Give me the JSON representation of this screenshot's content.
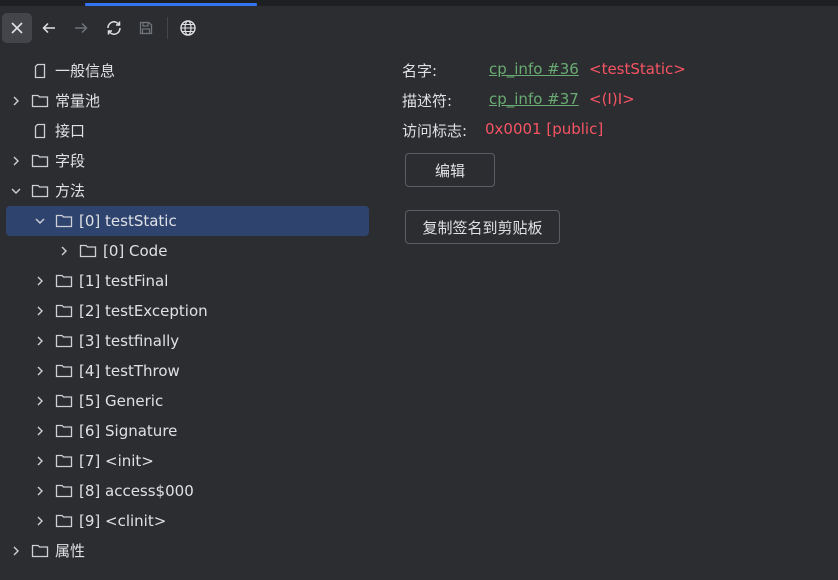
{
  "toolbar": {
    "close_icon": "close-icon",
    "back_icon": "arrow-left-icon",
    "forward_icon": "arrow-right-icon",
    "refresh_icon": "refresh-icon",
    "save_icon": "save-icon",
    "web_icon": "globe-icon"
  },
  "tree": {
    "items": [
      {
        "label": "一般信息"
      },
      {
        "label": "常量池"
      },
      {
        "label": "接口"
      },
      {
        "label": "字段"
      },
      {
        "label": "方法"
      },
      {
        "label": "[0] testStatic"
      },
      {
        "label": "[0] Code"
      },
      {
        "label": "[1] testFinal"
      },
      {
        "label": "[2] testException"
      },
      {
        "label": "[3] testfinally"
      },
      {
        "label": "[4] testThrow"
      },
      {
        "label": "[5] Generic"
      },
      {
        "label": "[6] Signature"
      },
      {
        "label": "[7] <init>"
      },
      {
        "label": "[8] access$000"
      },
      {
        "label": "[9] <clinit>"
      },
      {
        "label": "属性"
      }
    ]
  },
  "detail": {
    "name_label": "名字:",
    "name_link": "cp_info #36",
    "name_value": "<testStatic>",
    "descriptor_label": "描述符:",
    "descriptor_link": "cp_info #37",
    "descriptor_value": "<(I)I>",
    "access_label": "访问标志:",
    "access_value": "0x0001 [public]",
    "edit_button": "编辑",
    "copy_button": "复制签名到剪贴板"
  },
  "colors": {
    "background": "#2b2d30",
    "selection": "#2e436e",
    "link_green": "#6aab73",
    "value_red": "#f75464",
    "accent": "#3574f0"
  }
}
